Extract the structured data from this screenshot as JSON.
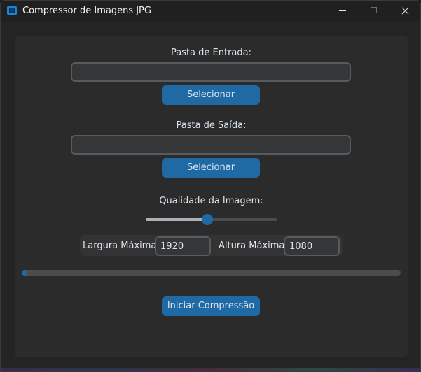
{
  "window": {
    "title": "Compressor de Imagens JPG",
    "icon": "app-icon"
  },
  "input_folder": {
    "label": "Pasta de Entrada:",
    "value": "",
    "button_label": "Selecionar"
  },
  "output_folder": {
    "label": "Pasta de Saída:",
    "value": "",
    "button_label": "Selecionar"
  },
  "quality": {
    "label": "Qualidade da Imagem:",
    "value_fraction": 0.47
  },
  "dimensions": {
    "width_label": "Largura Máxima:",
    "width_value": "1920",
    "height_label": "Altura Máxima:",
    "height_value": "1080"
  },
  "progress": {
    "value_fraction": 0.015
  },
  "actions": {
    "start_label": "Iniciar Compressão"
  },
  "colors": {
    "accent": "#1f6aa5",
    "background": "#242424",
    "panel": "#2b2b2b",
    "text": "#dce4ee"
  }
}
